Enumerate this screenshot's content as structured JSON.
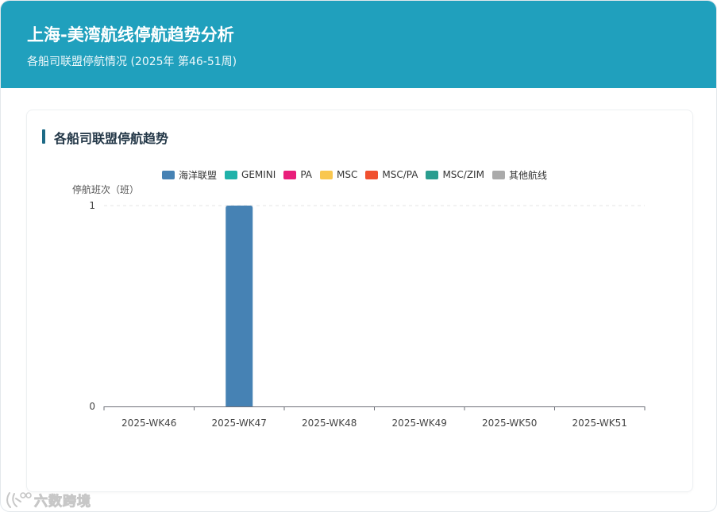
{
  "header": {
    "title": "上海-美湾航线停航趋势分析",
    "subtitle": "各船司联盟停航情况 (2025年 第46-51周)"
  },
  "card": {
    "title": "各船司联盟停航趋势"
  },
  "watermark": {
    "text": "六数跨境"
  },
  "chart_data": {
    "type": "bar",
    "ylabel": "停航班次（班）",
    "xlabel": "",
    "ylim": [
      0,
      1
    ],
    "yticks": [
      "0",
      "1"
    ],
    "grid": true,
    "legend_position": "top",
    "categories": [
      "2025-WK46",
      "2025-WK47",
      "2025-WK48",
      "2025-WK49",
      "2025-WK50",
      "2025-WK51"
    ],
    "series": [
      {
        "name": "海洋联盟",
        "color": "#4682b4",
        "values": [
          0,
          1,
          0,
          0,
          0,
          0
        ]
      },
      {
        "name": "GEMINI",
        "color": "#20b2aa",
        "values": [
          0,
          0,
          0,
          0,
          0,
          0
        ]
      },
      {
        "name": "PA",
        "color": "#e91e7a",
        "values": [
          0,
          0,
          0,
          0,
          0,
          0
        ]
      },
      {
        "name": "MSC",
        "color": "#f9c74f",
        "values": [
          0,
          0,
          0,
          0,
          0,
          0
        ]
      },
      {
        "name": "MSC/PA",
        "color": "#f0502f",
        "values": [
          0,
          0,
          0,
          0,
          0,
          0
        ]
      },
      {
        "name": "MSC/ZIM",
        "color": "#2a9d8f",
        "values": [
          0,
          0,
          0,
          0,
          0,
          0
        ]
      },
      {
        "name": "其他航线",
        "color": "#aaaaaa",
        "values": [
          0,
          0,
          0,
          0,
          0,
          0
        ]
      }
    ]
  }
}
